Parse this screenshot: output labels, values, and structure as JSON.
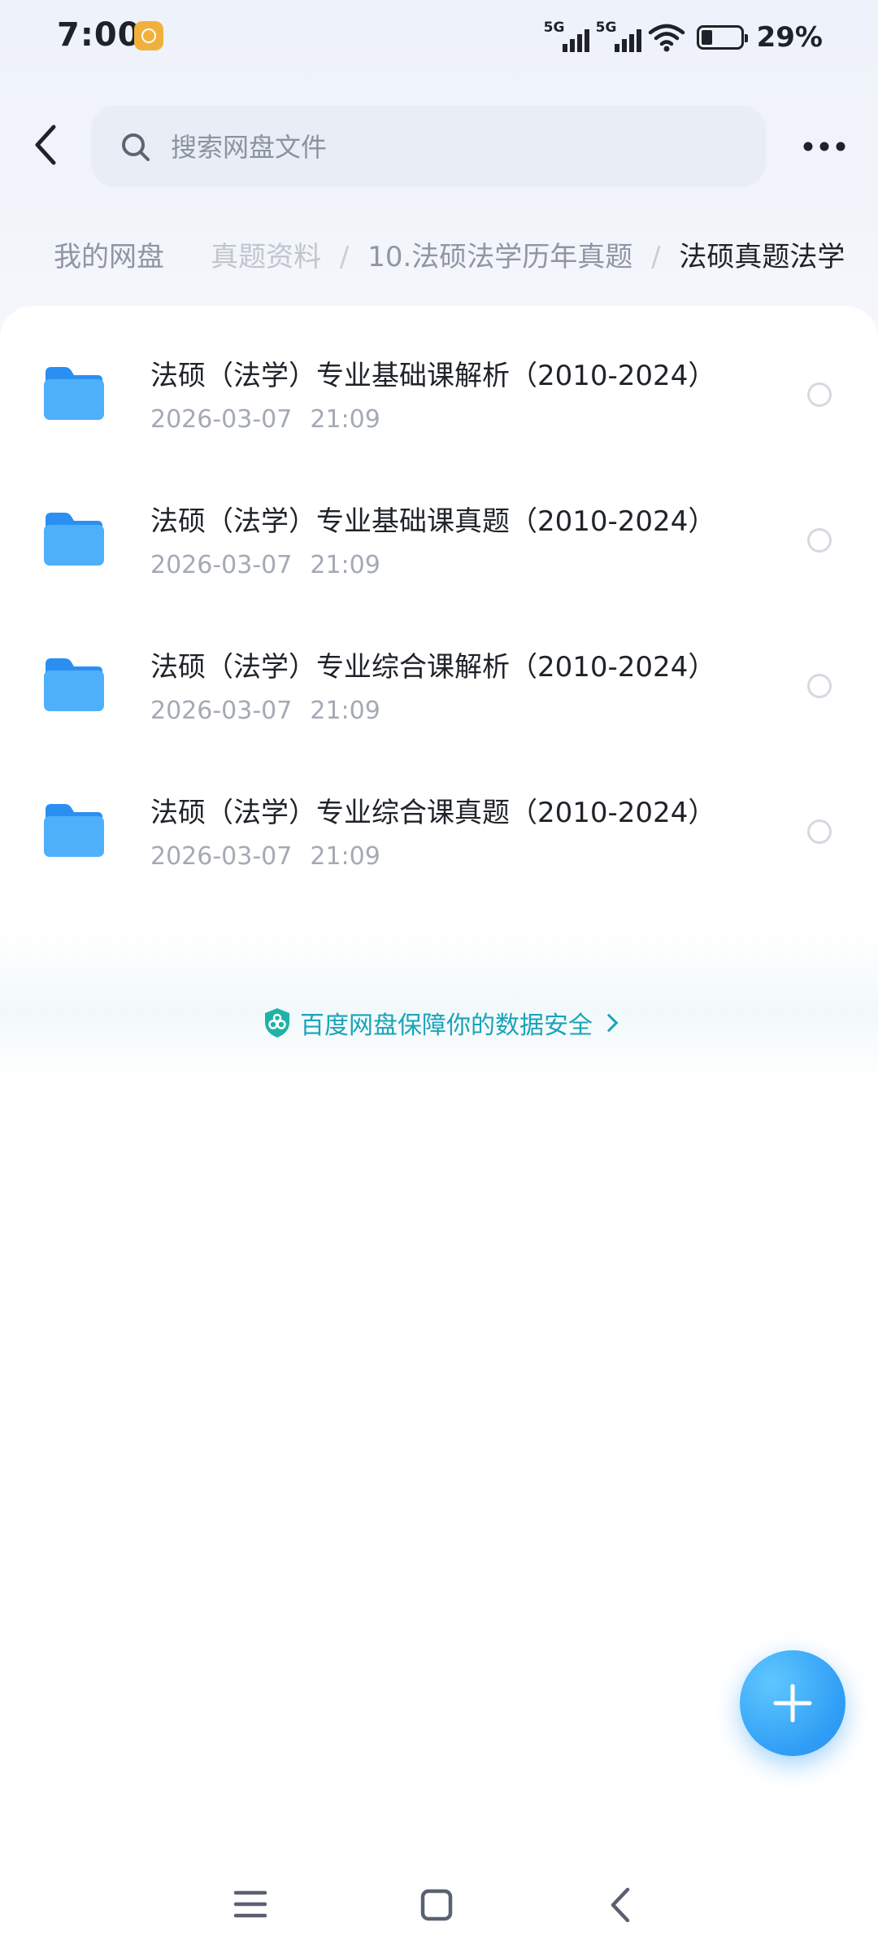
{
  "status_bar": {
    "time": "7:00",
    "signal_1_label": "5G",
    "signal_2_label": "5G",
    "battery_percent": "29%",
    "battery_level": 0.29
  },
  "header": {
    "search_placeholder": "搜索网盘文件"
  },
  "breadcrumb": {
    "items": [
      "我的网盘",
      "真题资料",
      "10.法硕法学历年真题",
      "法硕真题法学"
    ],
    "separator": "/"
  },
  "files": [
    {
      "name": "法硕（法学）专业基础课解析（2010-2024）",
      "date": "2026-03-07",
      "time": "21:09"
    },
    {
      "name": "法硕（法学）专业基础课真题（2010-2024）",
      "date": "2026-03-07",
      "time": "21:09"
    },
    {
      "name": "法硕（法学）专业综合课解析（2010-2024）",
      "date": "2026-03-07",
      "time": "21:09"
    },
    {
      "name": "法硕（法学）专业综合课真题（2010-2024）",
      "date": "2026-03-07",
      "time": "21:09"
    }
  ],
  "security": {
    "text": "百度网盘保障你的数据安全"
  },
  "icons": {
    "back": "back-arrow-icon",
    "search": "search-icon",
    "more": "more-dots-icon",
    "folder": "folder-icon",
    "fab": "plus-icon",
    "shield": "shield-icon",
    "nav_menu": "menu-icon",
    "nav_home": "home-icon",
    "nav_back": "back-icon"
  },
  "colors": {
    "accent": "#2f9df5",
    "security_text": "#1aa3b8",
    "folder": "#3a9df5",
    "secondary_text": "#a4aab5"
  }
}
